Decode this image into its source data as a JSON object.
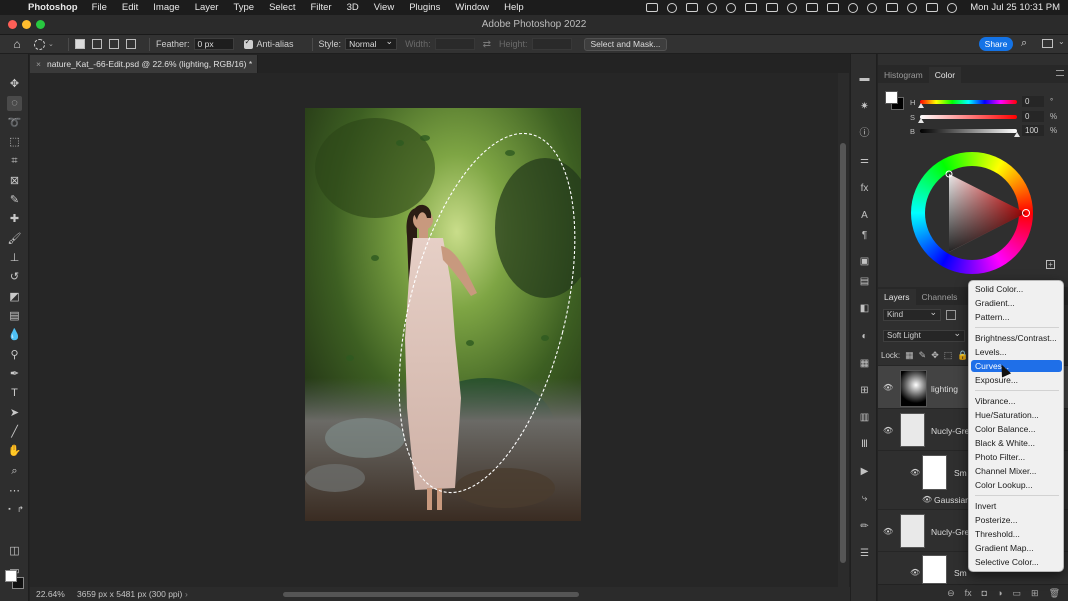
{
  "menubar": {
    "app": "Photoshop",
    "items": [
      "File",
      "Edit",
      "Image",
      "Layer",
      "Type",
      "Select",
      "Filter",
      "3D",
      "View",
      "Plugins",
      "Window",
      "Help"
    ],
    "clock": "Mon Jul 25  10:31 PM"
  },
  "window": {
    "title": "Adobe Photoshop 2022"
  },
  "options": {
    "feather_label": "Feather:",
    "feather_value": "0 px",
    "antialias_label": "Anti-alias",
    "antialias_checked": true,
    "style_label": "Style:",
    "style_value": "Normal",
    "width_label": "Width:",
    "height_label": "Height:",
    "select_mask_label": "Select and Mask...",
    "share_label": "Share"
  },
  "document": {
    "tab_title": "nature_Kat_-66-Edit.psd @ 22.6% (lighting, RGB/16) *",
    "zoom": "22.64%",
    "dimensions": "3659 px x 5481 px (300 ppi)"
  },
  "color_panel": {
    "tabs": [
      "Histogram",
      "Color"
    ],
    "active_tab": "Color",
    "sliders": [
      {
        "label": "H",
        "value": "0",
        "unit": "°"
      },
      {
        "label": "S",
        "value": "0",
        "unit": "%"
      },
      {
        "label": "B",
        "value": "100",
        "unit": "%"
      }
    ],
    "foreground": "#ffffff",
    "background": "#000000"
  },
  "layers_panel": {
    "tabs": [
      "Layers",
      "Channels",
      "P"
    ],
    "active_tab": "Layers",
    "filter_kind": "Kind",
    "blend_mode": "Soft Light",
    "lock_label": "Lock:",
    "layers": [
      {
        "name": "lighting",
        "selected": true
      },
      {
        "name": "Nucly-Gre"
      },
      {
        "name": "Sm"
      },
      {
        "name": "Gaussian"
      },
      {
        "name": "Nucly-Gre"
      },
      {
        "name": "Sm"
      }
    ]
  },
  "adjustments_menu": {
    "groups": [
      [
        "Solid Color...",
        "Gradient...",
        "Pattern..."
      ],
      [
        "Brightness/Contrast...",
        "Levels...",
        "Curves...",
        "Exposure..."
      ],
      [
        "Vibrance...",
        "Hue/Saturation...",
        "Color Balance...",
        "Black & White...",
        "Photo Filter...",
        "Channel Mixer...",
        "Color Lookup..."
      ],
      [
        "Invert",
        "Posterize...",
        "Threshold...",
        "Gradient Map...",
        "Selective Color..."
      ]
    ],
    "highlighted": "Curves..."
  },
  "colors": {
    "accent": "#1473e6",
    "menu_highlight": "#1f6fe8",
    "canvas_bg": "#262626"
  }
}
